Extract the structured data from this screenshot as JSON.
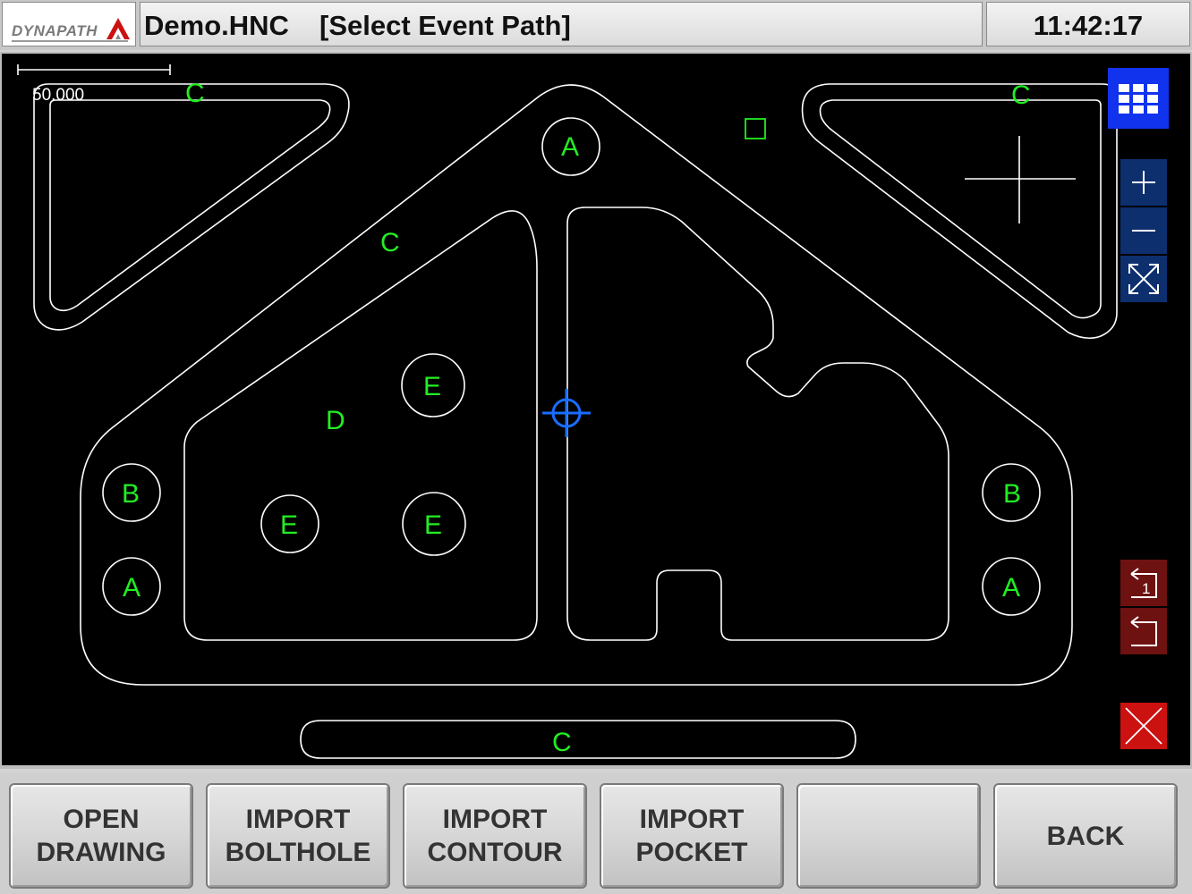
{
  "header": {
    "logo_text": "DYNAPATH",
    "file_name": "Demo.HNC",
    "mode_title": "[Select Event Path]",
    "clock": "11:42:17"
  },
  "drawing": {
    "scale_label": "50.000",
    "labels": [
      {
        "id": "c-top-left",
        "text": "C"
      },
      {
        "id": "c-top-right",
        "text": "C"
      },
      {
        "id": "c-diagonal",
        "text": "C"
      },
      {
        "id": "c-bottom",
        "text": "C"
      },
      {
        "id": "a-top",
        "text": "A"
      },
      {
        "id": "a-left",
        "text": "A"
      },
      {
        "id": "a-right",
        "text": "A"
      },
      {
        "id": "b-left",
        "text": "B"
      },
      {
        "id": "b-right",
        "text": "B"
      },
      {
        "id": "d-pocket",
        "text": "D"
      },
      {
        "id": "e-top",
        "text": "E"
      },
      {
        "id": "e-left",
        "text": "E"
      },
      {
        "id": "e-right",
        "text": "E"
      }
    ]
  },
  "tools": {
    "menu": "grid-menu-icon",
    "zoom_in": "zoom-in-icon",
    "zoom_out": "zoom-out-icon",
    "fit": "fit-view-icon",
    "undo_one": "undo-one-icon",
    "undo_all": "undo-all-icon",
    "cancel": "close-icon",
    "undo_one_digit": "1"
  },
  "colors": {
    "geometry": "#ffffff",
    "labels": "#22ee22",
    "cursor": "#1a6dff",
    "menu_button": "#1133ee",
    "zoom_buttons": "#0d2f6e",
    "undo_buttons": "#6e1111",
    "cancel_button": "#cc1111"
  },
  "softkeys": [
    {
      "id": "open-drawing",
      "label": "OPEN\nDRAWING"
    },
    {
      "id": "import-bolthole",
      "label": "IMPORT\nBOLTHOLE"
    },
    {
      "id": "import-contour",
      "label": "IMPORT\nCONTOUR"
    },
    {
      "id": "import-pocket",
      "label": "IMPORT\nPOCKET"
    },
    {
      "id": "blank",
      "label": ""
    },
    {
      "id": "back",
      "label": "BACK"
    }
  ]
}
